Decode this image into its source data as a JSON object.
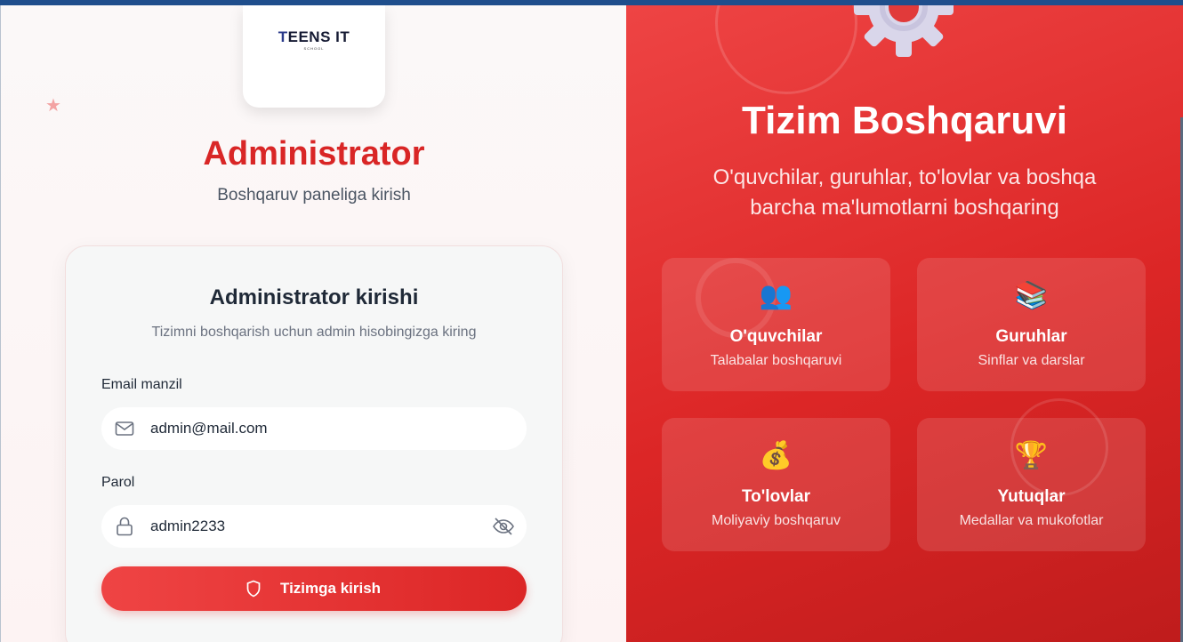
{
  "brand": {
    "logo_text": "EENS IT",
    "logo_initial": "T",
    "logo_sub": "SCHOOL"
  },
  "left": {
    "title": "Administrator",
    "subtitle": "Boshqaruv paneliga kirish",
    "form": {
      "title": "Administrator kirishi",
      "description": "Tizimni boshqarish uchun admin hisobingizga kiring",
      "email_label": "Email manzil",
      "email_value": "admin@mail.com",
      "password_label": "Parol",
      "password_value": "admin2233",
      "submit_label": "Tizimga kirish"
    }
  },
  "right": {
    "title": "Tizim Boshqaruvi",
    "description_line1": "O'quvchilar, guruhlar, to'lovlar va boshqa",
    "description_line2": "barcha ma'lumotlarni boshqaring",
    "features": [
      {
        "icon": "👥",
        "title": "O'quvchilar",
        "subtitle": "Talabalar boshqaruvi"
      },
      {
        "icon": "📚",
        "title": "Guruhlar",
        "subtitle": "Sinflar va darslar"
      },
      {
        "icon": "💰",
        "title": "To'lovlar",
        "subtitle": "Moliyaviy boshqaruv"
      },
      {
        "icon": "🏆",
        "title": "Yutuqlar",
        "subtitle": "Medallar va mukofotlar"
      }
    ]
  },
  "colors": {
    "accent": "#d92626",
    "panel": "#dc2626",
    "topbar": "#1f4e8c"
  },
  "icons": [
    "star-icon",
    "mail-icon",
    "lock-icon",
    "eye-off-icon",
    "shield-icon",
    "gear-icon"
  ]
}
